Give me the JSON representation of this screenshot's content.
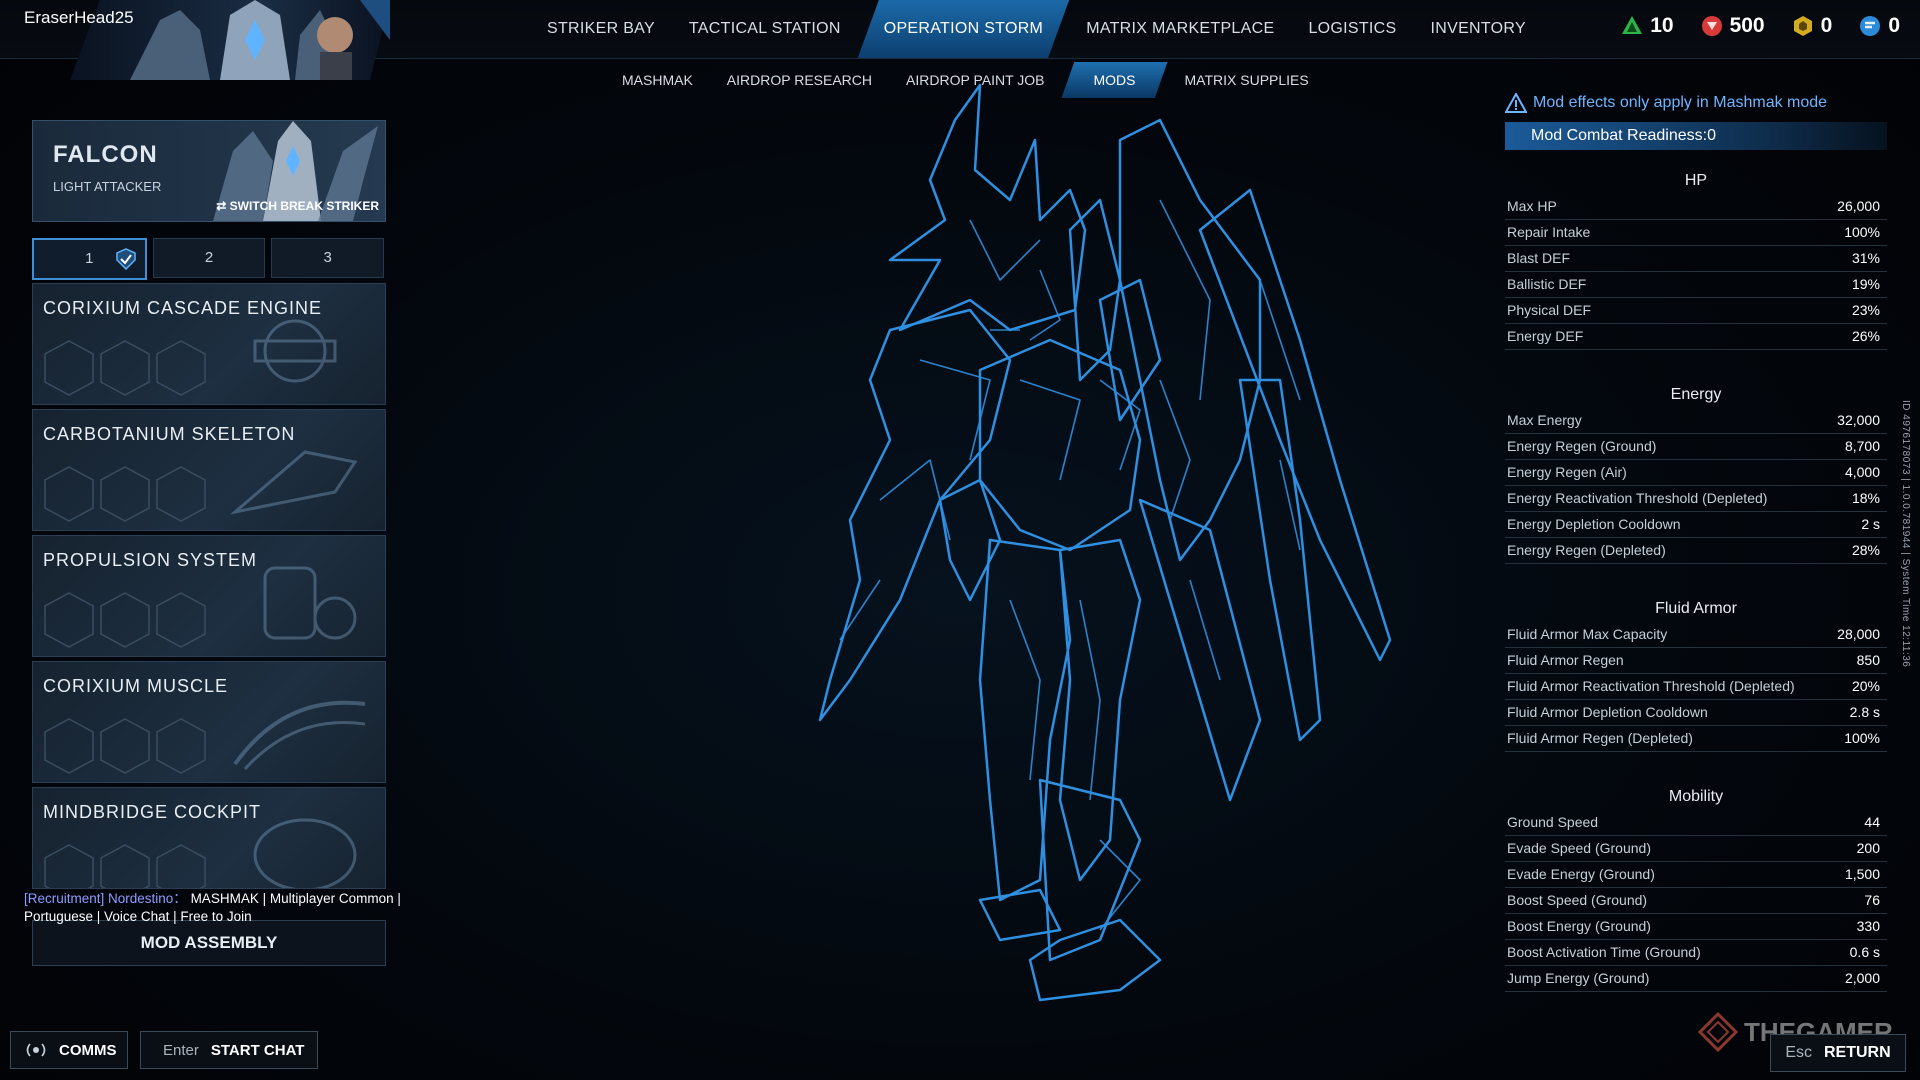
{
  "player": {
    "name": "EraserHead25"
  },
  "main_nav": [
    {
      "label": "STRIKER BAY"
    },
    {
      "label": "TACTICAL STATION"
    },
    {
      "label": "OPERATION STORM"
    },
    {
      "label": "MATRIX MARKETPLACE"
    },
    {
      "label": "LOGISTICS"
    },
    {
      "label": "INVENTORY"
    }
  ],
  "main_nav_active": "OPERATION STORM",
  "currencies": [
    {
      "icon": "green-crystal-icon",
      "value": "10"
    },
    {
      "icon": "red-emblem-icon",
      "value": "500"
    },
    {
      "icon": "gold-cube-icon",
      "value": "0"
    },
    {
      "icon": "blue-token-icon",
      "value": "0"
    }
  ],
  "sub_nav": [
    {
      "label": "MASHMAK"
    },
    {
      "label": "AIRDROP RESEARCH"
    },
    {
      "label": "AIRDROP PAINT JOB"
    },
    {
      "label": "MODS"
    },
    {
      "label": "MATRIX SUPPLIES"
    }
  ],
  "sub_nav_active": "MODS",
  "striker": {
    "name": "FALCON",
    "class": "LIGHT ATTACKER",
    "switch_label": "SWITCH BREAK STRIKER"
  },
  "loadouts": [
    {
      "label": "1"
    },
    {
      "label": "2"
    },
    {
      "label": "3"
    }
  ],
  "mod_slots": [
    {
      "label": "CORIXIUM CASCADE ENGINE"
    },
    {
      "label": "CARBOTANIUM SKELETON"
    },
    {
      "label": "PROPULSION SYSTEM"
    },
    {
      "label": "CORIXIUM MUSCLE"
    },
    {
      "label": "MINDBRIDGE COCKPIT"
    }
  ],
  "recruitment": {
    "tag": "[Recruitment] Nordestino：",
    "line1": " MASHMAK | Multiplayer Common |",
    "line2": "Portuguese | Voice Chat | Free to Join"
  },
  "mod_assembly_label": "MOD ASSEMBLY",
  "bottom": {
    "comms_label": "COMMS",
    "chat_key": "Enter",
    "chat_label": "START CHAT",
    "return_key": "Esc",
    "return_label": "RETURN"
  },
  "notice": "Mod effects only apply in Mashmak mode",
  "readiness": "Mod Combat Readiness:0",
  "stats": [
    {
      "title": "HP",
      "rows": [
        {
          "name": "Max HP",
          "value": "26,000"
        },
        {
          "name": "Repair Intake",
          "value": "100%"
        },
        {
          "name": "Blast DEF",
          "value": "31%"
        },
        {
          "name": "Ballistic DEF",
          "value": "19%"
        },
        {
          "name": "Physical DEF",
          "value": "23%"
        },
        {
          "name": "Energy DEF",
          "value": "26%"
        }
      ]
    },
    {
      "title": "Energy",
      "rows": [
        {
          "name": "Max Energy",
          "value": "32,000"
        },
        {
          "name": "Energy Regen (Ground)",
          "value": "8,700"
        },
        {
          "name": "Energy Regen (Air)",
          "value": "4,000"
        },
        {
          "name": "Energy Reactivation Threshold (Depleted)",
          "value": "18%"
        },
        {
          "name": "Energy Depletion Cooldown",
          "value": "2 s"
        },
        {
          "name": "Energy Regen (Depleted)",
          "value": "28%"
        }
      ]
    },
    {
      "title": "Fluid Armor",
      "rows": [
        {
          "name": "Fluid Armor Max Capacity",
          "value": "28,000"
        },
        {
          "name": "Fluid Armor Regen",
          "value": "850"
        },
        {
          "name": "Fluid Armor Reactivation Threshold (Depleted)",
          "value": "20%"
        },
        {
          "name": "Fluid Armor Depletion Cooldown",
          "value": "2.8 s"
        },
        {
          "name": "Fluid Armor Regen (Depleted)",
          "value": "100%"
        }
      ]
    },
    {
      "title": "Mobility",
      "rows": [
        {
          "name": "Ground Speed",
          "value": "44"
        },
        {
          "name": "Evade Speed (Ground)",
          "value": "200"
        },
        {
          "name": "Evade Energy (Ground)",
          "value": "1,500"
        },
        {
          "name": "Boost Speed (Ground)",
          "value": "76"
        },
        {
          "name": "Boost Energy (Ground)",
          "value": "330"
        },
        {
          "name": "Boost Activation Time (Ground)",
          "value": "0.6 s"
        },
        {
          "name": "Jump Energy (Ground)",
          "value": "2,000"
        }
      ]
    }
  ],
  "system_info": "ID 4976178073 | 1.0.0.781944 | System Time 12:11:36",
  "watermark": "THEGAMER",
  "colors": {
    "accent": "#1e70b0",
    "notice": "#6fb4ff",
    "mech_line": "#2f8fe0"
  }
}
